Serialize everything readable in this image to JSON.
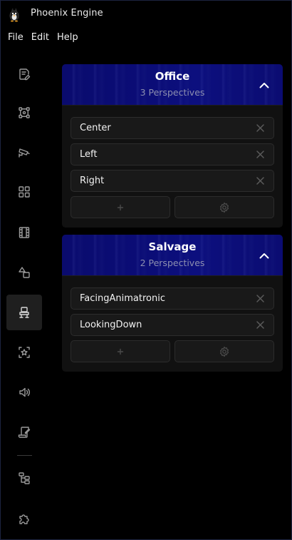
{
  "app": {
    "title": "Phoenix Engine",
    "logo_icon": "phoenix-logo-icon"
  },
  "menu": {
    "items": [
      {
        "label": "File"
      },
      {
        "label": "Edit"
      },
      {
        "label": "Help"
      }
    ]
  },
  "sidebar": {
    "items": [
      {
        "icon": "document-edit-icon",
        "active": false
      },
      {
        "icon": "node-graph-icon",
        "active": false
      },
      {
        "icon": "security-camera-icon",
        "active": false
      },
      {
        "icon": "grid-icon",
        "active": false
      },
      {
        "icon": "film-icon",
        "active": false
      },
      {
        "icon": "shapes-icon",
        "active": false
      },
      {
        "icon": "desk-chair-icon",
        "active": true
      },
      {
        "icon": "sparkle-icon",
        "active": false
      },
      {
        "icon": "speaker-icon",
        "active": false
      },
      {
        "icon": "script-edit-icon",
        "active": false
      },
      {
        "icon": "hierarchy-icon",
        "active": false
      },
      {
        "icon": "puzzle-icon",
        "active": false
      }
    ]
  },
  "offices": [
    {
      "title": "Office",
      "subtitle": "3 Perspectives",
      "perspectives": [
        "Center",
        "Left",
        "Right"
      ]
    },
    {
      "title": "Salvage",
      "subtitle": "2 Perspectives",
      "perspectives": [
        "FacingAnimatronic",
        "LookingDown"
      ]
    }
  ],
  "colors": {
    "header_blue": "#0b0d78",
    "panel_bg": "#111111",
    "row_bg": "#191919",
    "row_border": "#2c2c2c",
    "icon_gray": "#9a9a9a",
    "muted_gray": "#505050"
  }
}
